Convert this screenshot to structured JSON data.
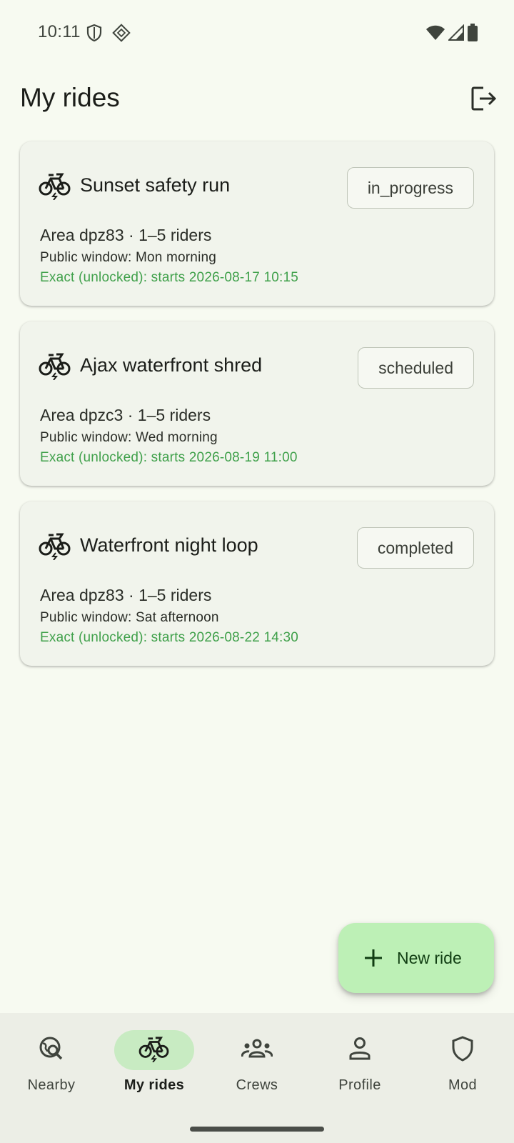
{
  "status_bar": {
    "time": "10:11",
    "left_icons": [
      "shield-icon",
      "diamond-app-icon"
    ],
    "right_icons": [
      "wifi-icon",
      "cell-signal-icon",
      "battery-icon"
    ]
  },
  "header": {
    "title": "My rides",
    "logout_icon": "logout-icon"
  },
  "rides": [
    {
      "title": "Sunset safety run",
      "status": "in_progress",
      "meta": "Area dpz83 · 1–5 riders",
      "public_window": "Public window: Mon morning",
      "exact": "Exact (unlocked): starts 2026-08-17 10:15"
    },
    {
      "title": "Ajax waterfront shred",
      "status": "scheduled",
      "meta": "Area dpzc3 · 1–5 riders",
      "public_window": "Public window: Wed morning",
      "exact": "Exact (unlocked): starts 2026-08-19 11:00"
    },
    {
      "title": "Waterfront night loop",
      "status": "completed",
      "meta": "Area dpz83 · 1–5 riders",
      "public_window": "Public window: Sat afternoon",
      "exact": "Exact (unlocked): starts 2026-08-22 14:30"
    }
  ],
  "fab": {
    "label": "New ride",
    "icon": "plus-icon"
  },
  "nav": {
    "items": [
      {
        "label": "Nearby",
        "icon": "nearby-search-icon",
        "active": false
      },
      {
        "label": "My rides",
        "icon": "ebike-icon",
        "active": true
      },
      {
        "label": "Crews",
        "icon": "group-icon",
        "active": false
      },
      {
        "label": "Profile",
        "icon": "person-icon",
        "active": false
      },
      {
        "label": "Mod",
        "icon": "shield-icon",
        "active": false
      }
    ]
  },
  "colors": {
    "background": "#f7faf1",
    "card": "#f1f4ec",
    "exact_text": "#3fa04a",
    "fab": "#bdf0b6",
    "nav_active_pill": "#c8ebc2"
  }
}
